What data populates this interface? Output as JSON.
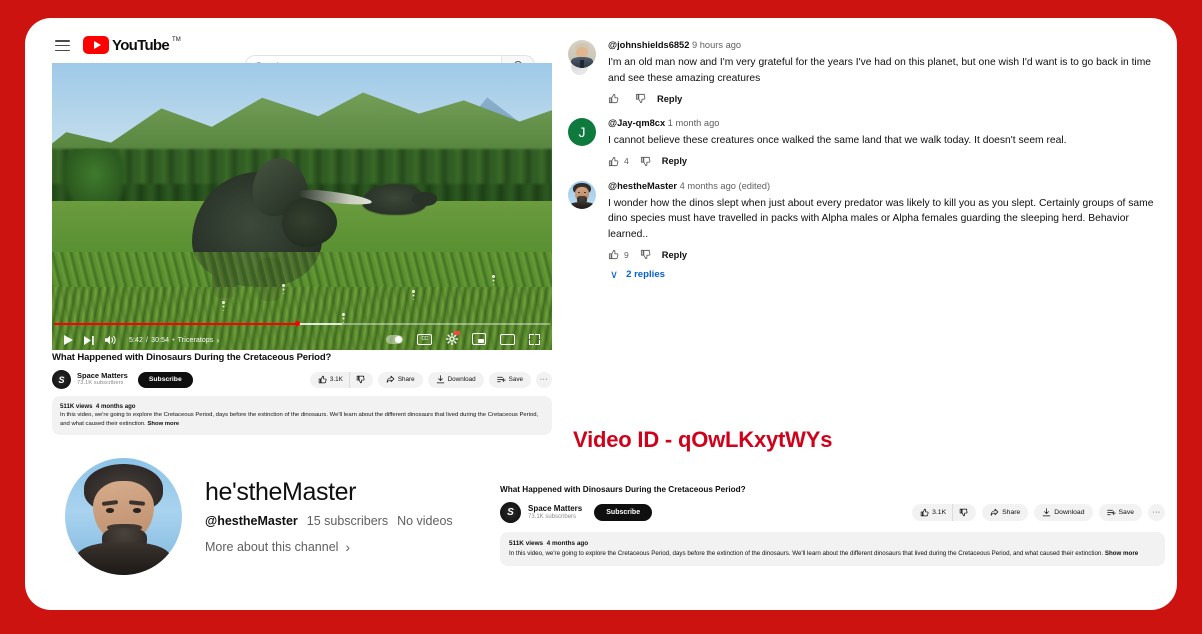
{
  "theme": {
    "frame_color": "#cd1310",
    "card_color": "#ffffff",
    "accent_red": "#d0021b",
    "link_blue": "#065fd4"
  },
  "header": {
    "menu_icon": "hamburger-icon",
    "logo_text": "YouTube",
    "logo_tm": "TM",
    "search_placeholder": "Search",
    "search_value": "",
    "search_icon": "search-icon"
  },
  "player": {
    "current_time": "5:42",
    "total_time": "30:54",
    "separator": "•",
    "chapter": "Triceratops",
    "chapter_arrow": "›",
    "play_icon": "play-icon",
    "next_icon": "next-track-icon",
    "volume_icon": "volume-icon",
    "autoplay_icon": "autoplay-toggle-icon",
    "captions_icon": "closed-captions-icon",
    "captions_label": "CC",
    "settings_icon": "gear-icon",
    "miniplayer_icon": "miniplayer-icon",
    "theater_icon": "theater-mode-icon",
    "fullscreen_icon": "fullscreen-icon",
    "progress_played_pct": 49,
    "progress_buffer_pct": 58
  },
  "video": {
    "title": "What Happened with Dinosaurs During the Cretaceous Period?",
    "channel_name": "Space Matters",
    "channel_initial": "S",
    "channel_subscribers": "73.1K subscribers",
    "subscribe_label": "Subscribe",
    "like_count": "3.1K",
    "like_icon": "thumbs-up-icon",
    "dislike_icon": "thumbs-down-icon",
    "share_label": "Share",
    "share_icon": "share-icon",
    "download_label": "Download",
    "download_icon": "download-icon",
    "save_label": "Save",
    "save_icon": "save-to-playlist-icon",
    "more_label": "···",
    "more_icon": "more-actions-icon",
    "views": "511K views",
    "published": "4 months ago",
    "description": "In this video, we're going to explore the Cretaceous Period, days before the extinction of the dinosaurs. We'll learn about the different dinosaurs that lived during the Cretaceous Period, and what caused their extinction.",
    "show_more_label": "Show more"
  },
  "comments": [
    {
      "avatar_name": "avatar-johnshields6852",
      "avatar_style": "av-johnshields",
      "author": "@johnshields6852",
      "timestamp": "9 hours ago",
      "text": "I'm an old man now and I'm very grateful for the years I've had on this planet, but one wish I'd want is to go back in time and see these amazing creatures",
      "like_count": "",
      "reply_label": "Reply",
      "replies_label": ""
    },
    {
      "avatar_name": "avatar-jay-qm8cx",
      "avatar_style": "av-jay",
      "avatar_letter": "J",
      "author": "@Jay-qm8cx",
      "timestamp": "1 month ago",
      "text": "I cannot believe these creatures once walked the same land that we walk today. It doesn't seem real.",
      "like_count": "4",
      "reply_label": "Reply",
      "replies_label": ""
    },
    {
      "avatar_name": "avatar-hesthemaster",
      "avatar_style": "av-hesthe",
      "author": "@hestheMaster",
      "timestamp": "4 months ago (edited)",
      "text": "I wonder how the dinos slept when just about every  predator was likely to kill you as you slept. Certainly groups of same\ndino species must have travelled in packs with Alpha males or Alpha females guarding the sleeping herd. Behavior learned..",
      "like_count": "9",
      "reply_label": "Reply",
      "replies_label": "2 replies"
    }
  ],
  "profile": {
    "display_name": "he'stheMaster",
    "handle": "@hestheMaster",
    "subscribers": "15 subscribers",
    "videos": "No videos",
    "more_label": "More about this channel",
    "more_arrow": "›",
    "avatar_name": "profile-avatar"
  },
  "annotation": {
    "video_id_label": "Video ID - qOwLKxytWYs"
  }
}
